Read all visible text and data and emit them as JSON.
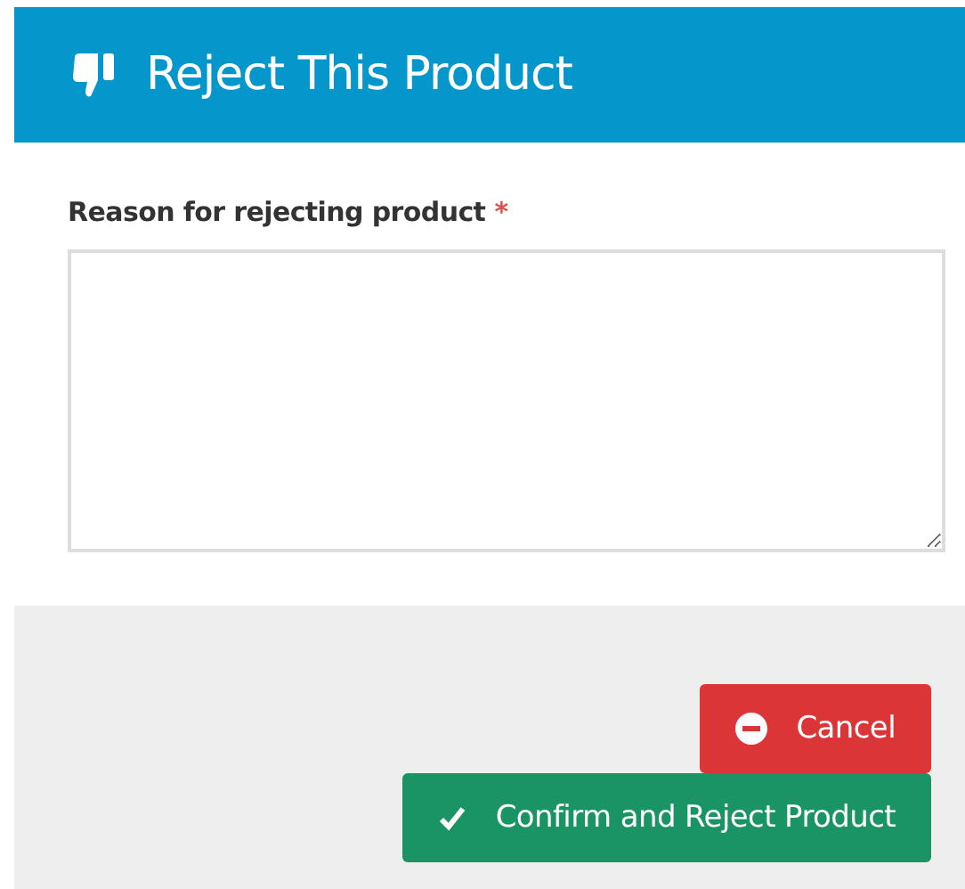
{
  "header": {
    "title": "Reject This Product"
  },
  "form": {
    "label": "Reason for rejecting product",
    "required_mark": "*"
  },
  "buttons": [
    {
      "label": "Cancel",
      "kind": "cancel"
    },
    {
      "label": "Confirm and Reject Product",
      "kind": "confirm"
    }
  ]
}
